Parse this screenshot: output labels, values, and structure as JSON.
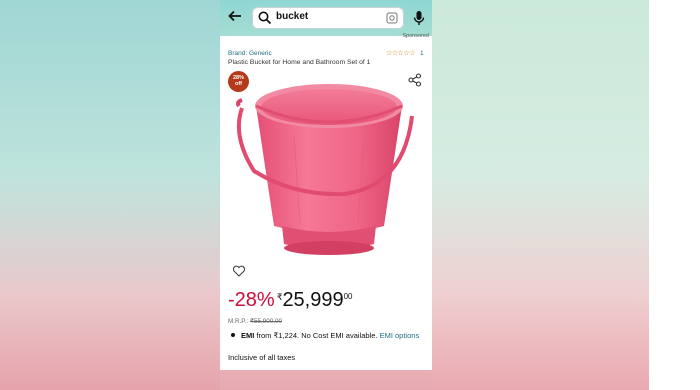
{
  "search": {
    "query": "bucket"
  },
  "sponsored_label": "Sponsored",
  "product": {
    "brand": "Brand: Generic",
    "rating_stars": "☆☆☆☆☆",
    "rating_value": 1,
    "rating_count": "1",
    "title": "Plastic Bucket for Home and Bathroom Set of 1",
    "badge_line1": "28%",
    "badge_line2": "off",
    "image_color": "#f06a8a"
  },
  "price": {
    "discount": "-28%",
    "currency": "₹",
    "whole": "25,999",
    "fraction": "00",
    "mrp_label": "M.R.P.:",
    "mrp_value": "₹55,900.00"
  },
  "emi": {
    "label": "EMI",
    "text": " from ₹1,224. No Cost EMI available. ",
    "link": "EMI options"
  },
  "taxes": "Inclusive of all taxes",
  "colors": {
    "accent_red": "#cc0c39",
    "link_teal": "#1f6d87",
    "badge": "#b53a1c",
    "header": "#8fd6d3"
  }
}
